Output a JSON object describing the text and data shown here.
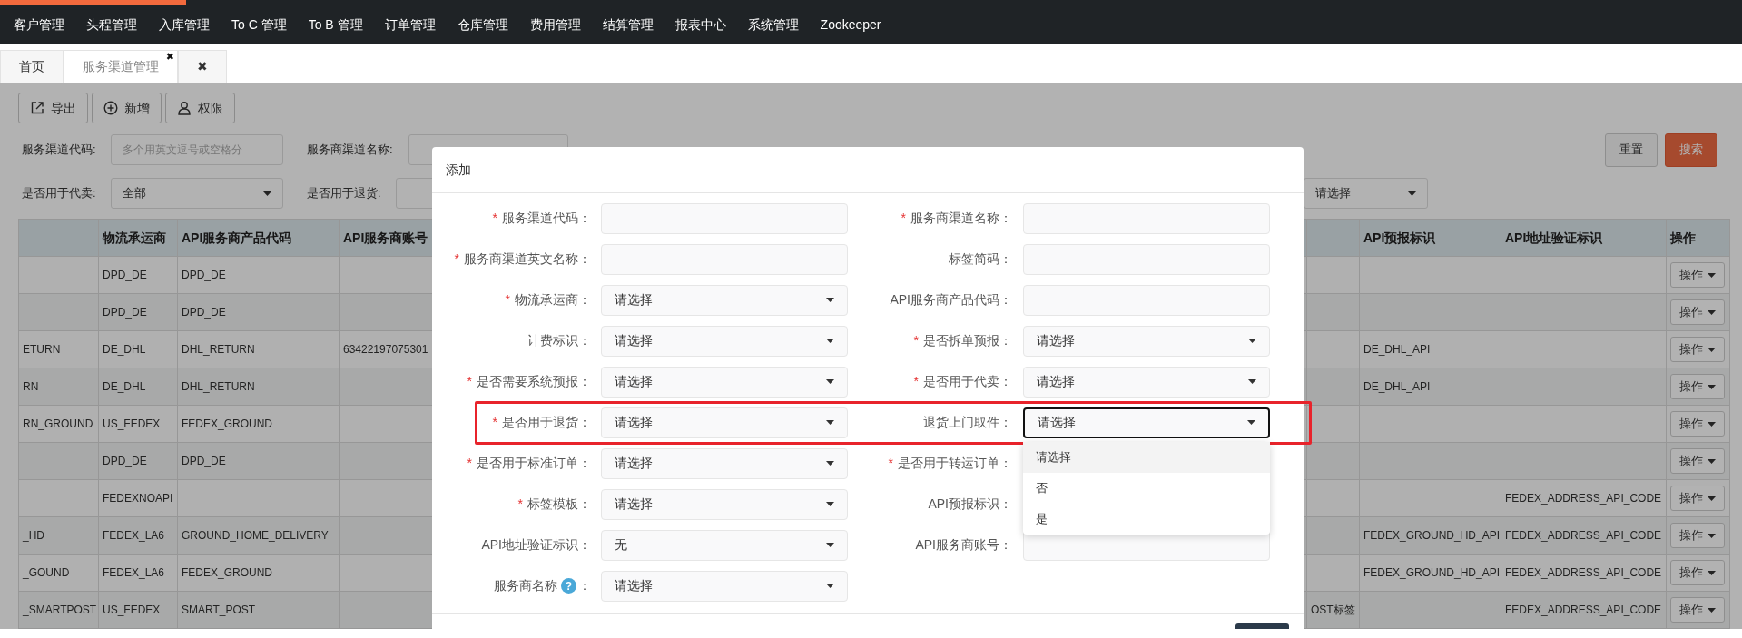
{
  "top_progress": {
    "level": 0.107
  },
  "nav": {
    "items": [
      "客户管理",
      "头程管理",
      "入库管理",
      "To C 管理",
      "To B 管理",
      "订单管理",
      "仓库管理",
      "费用管理",
      "结算管理",
      "报表中心",
      "系统管理",
      "Zookeeper"
    ]
  },
  "tabs": [
    {
      "label": "首页",
      "selected": false
    },
    {
      "label": "服务渠道管理",
      "selected": true,
      "close": "✖"
    },
    {
      "label": "✖",
      "selected": false
    }
  ],
  "toolbar": {
    "buttons": [
      {
        "label": "导出",
        "kind": "export"
      },
      {
        "label": "新增",
        "kind": "add"
      },
      {
        "label": "权限",
        "kind": "permission"
      }
    ]
  },
  "filters": {
    "rows": [
      {
        "items": [
          {
            "label": "服务渠道代码:",
            "kind": "input",
            "placeholder": "多个用英文逗号或空格分"
          },
          {
            "label": "服务商渠道名称:",
            "kind": "input"
          }
        ],
        "buttons": [
          {
            "label": "重置",
            "kind": "secondary"
          },
          {
            "label": "搜索",
            "kind": "primary"
          }
        ]
      },
      {
        "items": [
          {
            "label": "是否用于代卖:",
            "kind": "select",
            "value": "全部"
          },
          {
            "label": "是否用于退货:",
            "kind": "select"
          },
          {
            "kind": "select",
            "value": "请选择"
          }
        ]
      }
    ]
  },
  "table": {
    "columns": [
      null,
      "物流承运商",
      "API服务商产品代码",
      "API服务商账号",
      null,
      "API预报标识",
      "API地址验证标识",
      "操作"
    ],
    "rows": [
      {
        "cells": [
          null,
          "DPD_DE",
          "DPD_DE",
          null,
          null,
          null,
          null
        ],
        "action": "操作"
      },
      {
        "cells": [
          null,
          "DPD_DE",
          "DPD_DE",
          null,
          null,
          null,
          null
        ],
        "action": "操作"
      },
      {
        "cells": [
          "ETURN",
          "DE_DHL",
          "DHL_RETURN",
          "63422197075301",
          null,
          "DE_DHL_API",
          null
        ],
        "action": "操作"
      },
      {
        "cells": [
          "RN",
          "DE_DHL",
          "DHL_RETURN",
          null,
          null,
          "DE_DHL_API",
          null
        ],
        "action": "操作"
      },
      {
        "cells": [
          "RN_GROUND",
          "US_FEDEX",
          "FEDEX_GROUND",
          null,
          null,
          null,
          null
        ],
        "action": "操作"
      },
      {
        "cells": [
          null,
          "DPD_DE",
          "DPD_DE",
          null,
          null,
          null,
          null
        ],
        "action": "操作"
      },
      {
        "cells": [
          null,
          "FEDEXNOAPI",
          null,
          null,
          null,
          null,
          "FEDEX_ADDRESS_API_CODE"
        ],
        "action": "操作"
      },
      {
        "cells": [
          "_HD",
          "FEDEX_LA6",
          "GROUND_HOME_DELIVERY",
          null,
          null,
          "FEDEX_GROUND_HD_API",
          "FEDEX_ADDRESS_API_CODE"
        ],
        "action": "操作"
      },
      {
        "cells": [
          "_GOUND",
          "FEDEX_LA6",
          "FEDEX_GROUND",
          null,
          null,
          "FEDEX_GROUND_HD_API",
          "FEDEX_ADDRESS_API_CODE"
        ],
        "action": "操作"
      },
      {
        "cells": [
          "_SMARTPOST",
          "US_FEDEX",
          "SMART_POST",
          null,
          "OST标签",
          null,
          "FEDEX_ADDRESS_API_CODE"
        ],
        "action": "操作"
      }
    ]
  },
  "modal": {
    "title": "添加",
    "rows": [
      {
        "highlighted": false,
        "left": {
          "label": "服务渠道代码：",
          "required_mark": "*",
          "kind": "input"
        },
        "right": {
          "label": "服务商渠道名称：",
          "required_mark": "*",
          "kind": "input"
        }
      },
      {
        "highlighted": false,
        "left": {
          "label": "服务商渠道英文名称：",
          "required_mark": "*",
          "kind": "input"
        },
        "right": {
          "label": "标签简码：",
          "kind": "input"
        }
      },
      {
        "highlighted": false,
        "left": {
          "label": "物流承运商：",
          "required_mark": "*",
          "kind": "select",
          "value": "请选择"
        },
        "right": {
          "label": "API服务商产品代码：",
          "kind": "input"
        }
      },
      {
        "highlighted": false,
        "left": {
          "label": "计费标识：",
          "kind": "select",
          "value": "请选择"
        },
        "right": {
          "label": "是否拆单预报：",
          "required_mark": "*",
          "kind": "select",
          "value": "请选择"
        }
      },
      {
        "highlighted": false,
        "left": {
          "label": "是否需要系统预报：",
          "required_mark": "*",
          "kind": "select",
          "value": "请选择"
        },
        "right": {
          "label": "是否用于代卖：",
          "required_mark": "*",
          "kind": "select",
          "value": "请选择"
        }
      },
      {
        "highlighted": true,
        "left": {
          "label": "是否用于退货：",
          "required_mark": "*",
          "kind": "select",
          "value": "请选择"
        },
        "right": {
          "label": "退货上门取件：",
          "kind": "select",
          "value": "请选择",
          "focused": true,
          "options": [
            {
              "label": "请选择",
              "selected": true
            },
            {
              "label": "否",
              "selected": false
            },
            {
              "label": "是",
              "selected": false
            }
          ]
        }
      },
      {
        "highlighted": false,
        "left": {
          "label": "是否用于标准订单：",
          "required_mark": "*",
          "kind": "select",
          "value": "请选择"
        },
        "right": {
          "label": "是否用于转运订单：",
          "required_mark": "*",
          "kind": "select"
        }
      },
      {
        "highlighted": false,
        "left": {
          "label": "标签模板：",
          "required_mark": "*",
          "kind": "select",
          "value": "请选择"
        },
        "right": {
          "label": "API预报标识：",
          "kind": "input"
        }
      },
      {
        "highlighted": false,
        "left": {
          "label": "API地址验证标识：",
          "kind": "select",
          "value": "无"
        },
        "right": {
          "label": "API服务商账号：",
          "kind": "input"
        }
      },
      {
        "highlighted": false,
        "left": {
          "label": "服务商名称",
          "help": "?",
          "suffix": "：",
          "kind": "select",
          "value": "请选择"
        }
      }
    ],
    "footer": {
      "buttons": [
        {
          "kind": "primary"
        }
      ]
    }
  }
}
